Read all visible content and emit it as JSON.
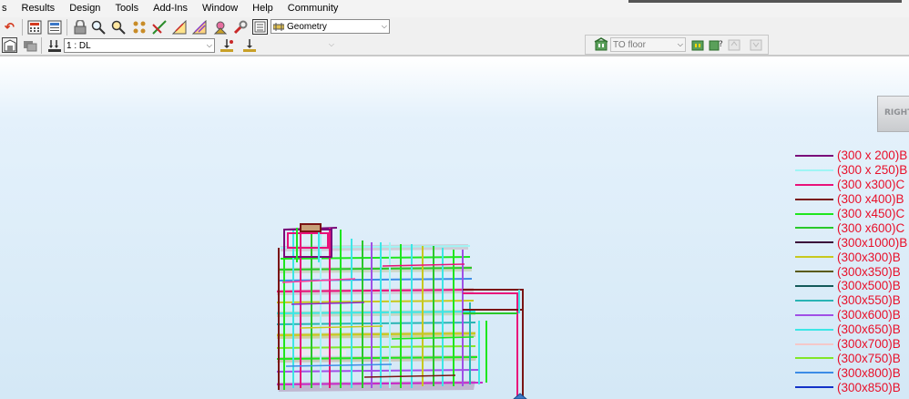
{
  "menubar": {
    "items": [
      "s",
      "Results",
      "Design",
      "Tools",
      "Add-Ins",
      "Window",
      "Help",
      "Community"
    ]
  },
  "toolbar1": {
    "structure_type": "Geometry",
    "icons": [
      "undo-icon",
      "calculator-icon",
      "calculator-results-icon",
      "lock-icon",
      "zoom-window-icon",
      "zoom-all-icon",
      "nodes-icon",
      "members-icon",
      "dimension-icon",
      "section-icon",
      "supports-icon",
      "tools-icon",
      "display-icon",
      "structure-type-icon"
    ]
  },
  "toolbar2": {
    "load_case": "1 : DL",
    "empty_combo": "",
    "icons": [
      "view-icon",
      "layers-icon",
      "load-case-icon",
      "load-next-icon",
      "load-definition-icon"
    ]
  },
  "floor_panel": {
    "floor_selector": "TO floor",
    "icons": [
      "floor-icon",
      "floor-next-icon",
      "floor-help-icon",
      "floor-up-icon",
      "floor-down-icon"
    ]
  },
  "viewcube": {
    "face_label": "RIGHT"
  },
  "legend": {
    "items": [
      {
        "label": "(300 x 200)B",
        "color": "#7a0b7a"
      },
      {
        "label": "(300 x 250)B",
        "color": "#9ff5f5"
      },
      {
        "label": "(300 x300)C",
        "color": "#e8127a"
      },
      {
        "label": "(300 x400)B",
        "color": "#7a1414"
      },
      {
        "label": "(300 x450)C",
        "color": "#1ee61e"
      },
      {
        "label": "(300 x600)C",
        "color": "#2ac82a"
      },
      {
        "label": "(300x1000)B",
        "color": "#3a0a3a"
      },
      {
        "label": "(300x300)B",
        "color": "#c8c81e"
      },
      {
        "label": "(300x350)B",
        "color": "#5a5a14"
      },
      {
        "label": "(300x500)B",
        "color": "#145a5a"
      },
      {
        "label": "(300x550)B",
        "color": "#2ab4b4"
      },
      {
        "label": "(300x600)B",
        "color": "#a050e6"
      },
      {
        "label": "(300x650)B",
        "color": "#3ce6e6"
      },
      {
        "label": "(300x700)B",
        "color": "#f5c8c8"
      },
      {
        "label": "(300x750)B",
        "color": "#82e628"
      },
      {
        "label": "(300x800)B",
        "color": "#3c8ce6"
      },
      {
        "label": "(300x850)B",
        "color": "#1432c8"
      }
    ]
  }
}
